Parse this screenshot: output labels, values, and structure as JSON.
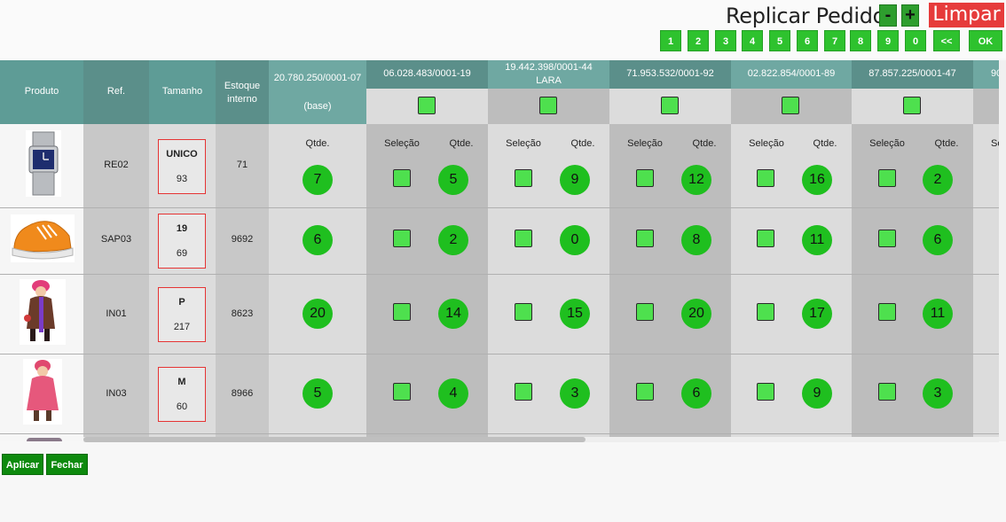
{
  "header": {
    "title": "Replicar Pedido",
    "minus_label": "-",
    "plus_label": "+",
    "limpar_label": "Limpar",
    "number_buttons": [
      "1",
      "2",
      "3",
      "4",
      "5",
      "6",
      "7",
      "8",
      "9",
      "0",
      "<<"
    ],
    "ok_label": "OK"
  },
  "columns": {
    "produto": "Produto",
    "ref": "Ref.",
    "tamanho": "Tamanho",
    "estoque": "Estoque interno",
    "base_cnpj": "20.780.250/0001-07",
    "base_label": "(base)",
    "qtde_label": "Qtde.",
    "selecao_label": "Seleção"
  },
  "stores": [
    {
      "cnpj": "06.028.483/0001-19",
      "name": ""
    },
    {
      "cnpj": "19.442.398/0001-44",
      "name": "LARA"
    },
    {
      "cnpj": "71.953.532/0001-92",
      "name": ""
    },
    {
      "cnpj": "02.822.854/0001-89",
      "name": ""
    },
    {
      "cnpj": "87.857.225/0001-47",
      "name": ""
    },
    {
      "cnpj": "90",
      "name": ""
    }
  ],
  "partial_selecao_label": "Se",
  "rows": [
    {
      "ref": "RE02",
      "size": "UNICO",
      "size_qty": "93",
      "stock": "71",
      "base_qty": "7",
      "qtys": [
        "5",
        "9",
        "12",
        "16",
        "2"
      ],
      "image": "watch-image"
    },
    {
      "ref": "SAP03",
      "size": "19",
      "size_qty": "69",
      "stock": "9692",
      "base_qty": "6",
      "qtys": [
        "2",
        "0",
        "8",
        "11",
        "6"
      ],
      "image": "shoe-image"
    },
    {
      "ref": "IN01",
      "size": "P",
      "size_qty": "217",
      "stock": "8623",
      "base_qty": "20",
      "qtys": [
        "14",
        "15",
        "20",
        "17",
        "11"
      ],
      "image": "girl-purple-coat-image"
    },
    {
      "ref": "IN03",
      "size": "M",
      "size_qty": "60",
      "stock": "8966",
      "base_qty": "5",
      "qtys": [
        "4",
        "3",
        "6",
        "9",
        "3"
      ],
      "image": "girl-pink-coat-image"
    }
  ],
  "footer": {
    "aplicar_label": "Aplicar",
    "fechar_label": "Fechar"
  },
  "colors": {
    "header_teal": "#5e9c96",
    "qty_green": "#1fbf1f",
    "checkbox_green": "#4ee04e",
    "limpar_red": "#e63b3b",
    "button_green": "#2ec22e",
    "dark_green": "#0e8a0e"
  }
}
